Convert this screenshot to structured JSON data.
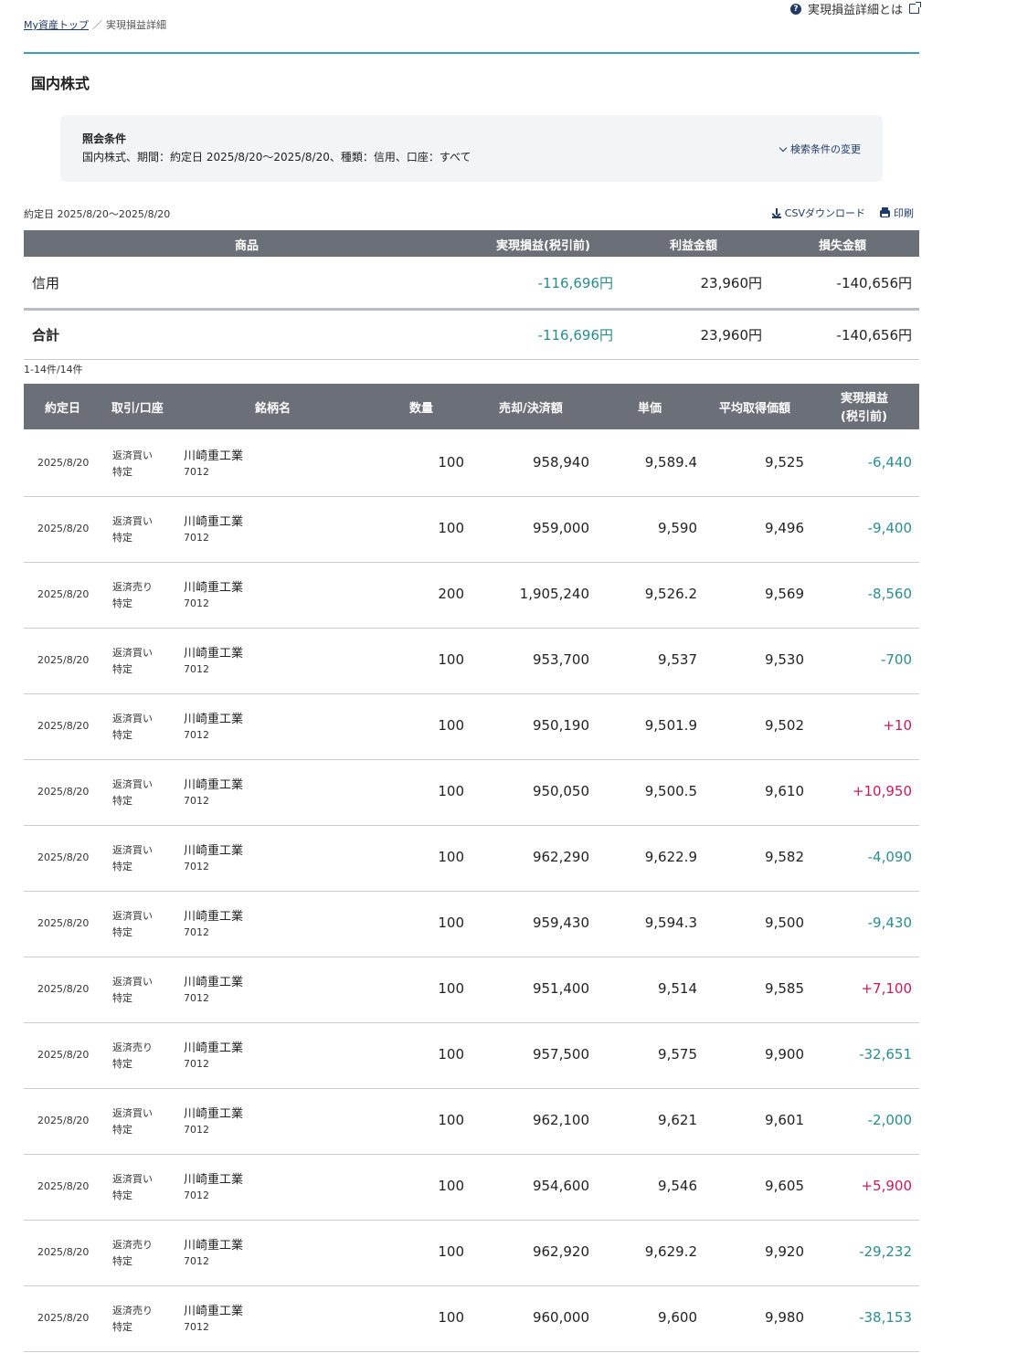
{
  "header": {
    "help_link": "実現損益詳細とは",
    "breadcrumb_home": "My資産トップ",
    "breadcrumb_sep": "／",
    "breadcrumb_current": "実現損益詳細",
    "title": "国内株式"
  },
  "condition": {
    "label": "照会条件",
    "text": "国内株式、期間：約定日 2025/8/20〜2025/8/20、種類：信用、口座：すべて",
    "change": "検索条件の変更"
  },
  "toolbar": {
    "period": "約定日 2025/8/20〜2025/8/20",
    "csv": "CSVダウンロード",
    "print": "印刷"
  },
  "summary": {
    "headers": [
      "商品",
      "実現損益(税引前)",
      "利益金額",
      "損失金額"
    ],
    "row": {
      "product": "信用",
      "pl": "-116,696円",
      "profit": "23,960円",
      "loss": "-140,656円"
    },
    "total": {
      "product": "合計",
      "pl": "-116,696円",
      "profit": "23,960円",
      "loss": "-140,656円"
    }
  },
  "count": "1-14件/14件",
  "detail": {
    "headers": {
      "date": "約定日",
      "trade": "取引/口座",
      "name": "銘柄名",
      "qty": "数量",
      "amount": "売却/決済額",
      "unit": "単価",
      "avg": "平均取得価額",
      "pl_line1": "実現損益",
      "pl_line2": "(税引前)"
    },
    "rows": [
      {
        "date": "2025/8/20",
        "trade": "返済買い",
        "account": "特定",
        "name": "川崎重工業",
        "code": "7012",
        "qty": "100",
        "amount": "958,940",
        "unit": "9,589.4",
        "avg": "9,525",
        "pl": "-6,440"
      },
      {
        "date": "2025/8/20",
        "trade": "返済買い",
        "account": "特定",
        "name": "川崎重工業",
        "code": "7012",
        "qty": "100",
        "amount": "959,000",
        "unit": "9,590",
        "avg": "9,496",
        "pl": "-9,400"
      },
      {
        "date": "2025/8/20",
        "trade": "返済売り",
        "account": "特定",
        "name": "川崎重工業",
        "code": "7012",
        "qty": "200",
        "amount": "1,905,240",
        "unit": "9,526.2",
        "avg": "9,569",
        "pl": "-8,560"
      },
      {
        "date": "2025/8/20",
        "trade": "返済買い",
        "account": "特定",
        "name": "川崎重工業",
        "code": "7012",
        "qty": "100",
        "amount": "953,700",
        "unit": "9,537",
        "avg": "9,530",
        "pl": "-700"
      },
      {
        "date": "2025/8/20",
        "trade": "返済買い",
        "account": "特定",
        "name": "川崎重工業",
        "code": "7012",
        "qty": "100",
        "amount": "950,190",
        "unit": "9,501.9",
        "avg": "9,502",
        "pl": "+10"
      },
      {
        "date": "2025/8/20",
        "trade": "返済買い",
        "account": "特定",
        "name": "川崎重工業",
        "code": "7012",
        "qty": "100",
        "amount": "950,050",
        "unit": "9,500.5",
        "avg": "9,610",
        "pl": "+10,950"
      },
      {
        "date": "2025/8/20",
        "trade": "返済買い",
        "account": "特定",
        "name": "川崎重工業",
        "code": "7012",
        "qty": "100",
        "amount": "962,290",
        "unit": "9,622.9",
        "avg": "9,582",
        "pl": "-4,090"
      },
      {
        "date": "2025/8/20",
        "trade": "返済買い",
        "account": "特定",
        "name": "川崎重工業",
        "code": "7012",
        "qty": "100",
        "amount": "959,430",
        "unit": "9,594.3",
        "avg": "9,500",
        "pl": "-9,430"
      },
      {
        "date": "2025/8/20",
        "trade": "返済買い",
        "account": "特定",
        "name": "川崎重工業",
        "code": "7012",
        "qty": "100",
        "amount": "951,400",
        "unit": "9,514",
        "avg": "9,585",
        "pl": "+7,100"
      },
      {
        "date": "2025/8/20",
        "trade": "返済売り",
        "account": "特定",
        "name": "川崎重工業",
        "code": "7012",
        "qty": "100",
        "amount": "957,500",
        "unit": "9,575",
        "avg": "9,900",
        "pl": "-32,651"
      },
      {
        "date": "2025/8/20",
        "trade": "返済買い",
        "account": "特定",
        "name": "川崎重工業",
        "code": "7012",
        "qty": "100",
        "amount": "962,100",
        "unit": "9,621",
        "avg": "9,601",
        "pl": "-2,000"
      },
      {
        "date": "2025/8/20",
        "trade": "返済買い",
        "account": "特定",
        "name": "川崎重工業",
        "code": "7012",
        "qty": "100",
        "amount": "954,600",
        "unit": "9,546",
        "avg": "9,605",
        "pl": "+5,900"
      },
      {
        "date": "2025/8/20",
        "trade": "返済売り",
        "account": "特定",
        "name": "川崎重工業",
        "code": "7012",
        "qty": "100",
        "amount": "962,920",
        "unit": "9,629.2",
        "avg": "9,920",
        "pl": "-29,232"
      },
      {
        "date": "2025/8/20",
        "trade": "返済売り",
        "account": "特定",
        "name": "川崎重工業",
        "code": "7012",
        "qty": "100",
        "amount": "960,000",
        "unit": "9,600",
        "avg": "9,980",
        "pl": "-38,153"
      }
    ]
  },
  "colors": {
    "accent_rule": "#3a9fb5",
    "header_bg": "#6a6f78",
    "negative": "#2b8c8c",
    "positive": "#c8195a",
    "link": "#1f3a64"
  }
}
